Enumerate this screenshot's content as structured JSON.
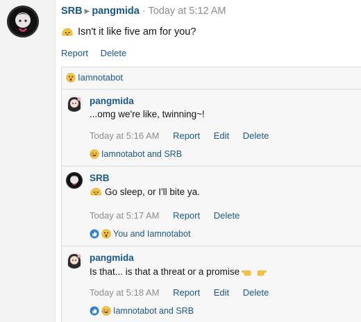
{
  "message": {
    "author": "SRB",
    "recipient": "pangmida",
    "separator": "·",
    "time": "Today at 5:12 AM",
    "text": "Isn't it like five am for you?",
    "actions": {
      "report": "Report",
      "delete": "Delete"
    }
  },
  "top_reactions": {
    "text": "Iamnotabot"
  },
  "replies": [
    {
      "author": "pangmida",
      "text": "...omg we're like, twinning~!",
      "time": "Today at 5:16 AM",
      "actions": [
        "Report",
        "Edit",
        "Delete"
      ],
      "reactions": "Iamnotabot and SRB"
    },
    {
      "author": "SRB",
      "text": "Go sleep, or I'll bite ya.",
      "time": "Today at 5:17 AM",
      "actions": [
        "Report",
        "Delete"
      ],
      "reactions": "You and Iamnotabot"
    },
    {
      "author": "pangmida",
      "text": "Is that... is that a threat or a promise",
      "time": "Today at 5:18 AM",
      "actions": [
        "Report",
        "Edit",
        "Delete"
      ],
      "reactions": "Iamnotabot and SRB"
    }
  ],
  "colors": {
    "link": "#185886",
    "meta": "#8c8c8c",
    "panel": "#f7f7f7",
    "emoji": "#f6c43a"
  }
}
